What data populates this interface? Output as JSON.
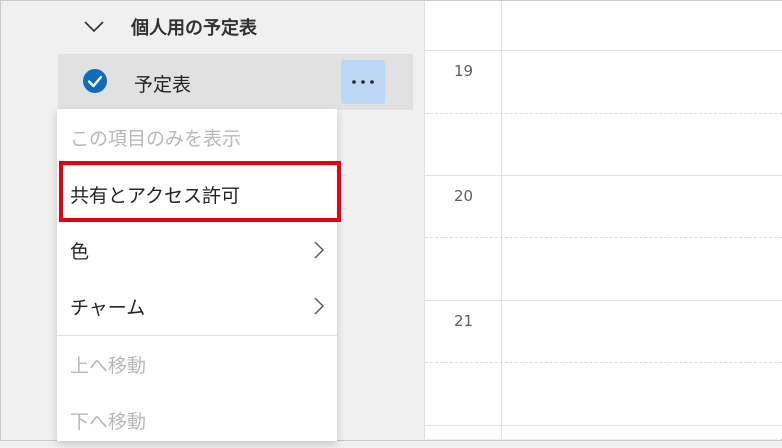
{
  "sidebar": {
    "group_title": "個人用の予定表",
    "calendar_label": "予定表"
  },
  "menu": {
    "items": [
      {
        "label": "この項目のみを表示",
        "disabled": true
      },
      {
        "label": "共有とアクセス許可",
        "disabled": false
      },
      {
        "label": "色",
        "disabled": false,
        "submenu": true
      },
      {
        "label": "チャーム",
        "disabled": false,
        "submenu": true
      },
      {
        "label": "上へ移動",
        "disabled": true
      },
      {
        "label": "下へ移動",
        "disabled": true
      }
    ]
  },
  "timegrid": {
    "hours": [
      "19",
      "20",
      "21"
    ]
  },
  "colors": {
    "accent": "#0f6cbd",
    "highlight": "#e60012",
    "selected_button": "#bcd6f5"
  }
}
